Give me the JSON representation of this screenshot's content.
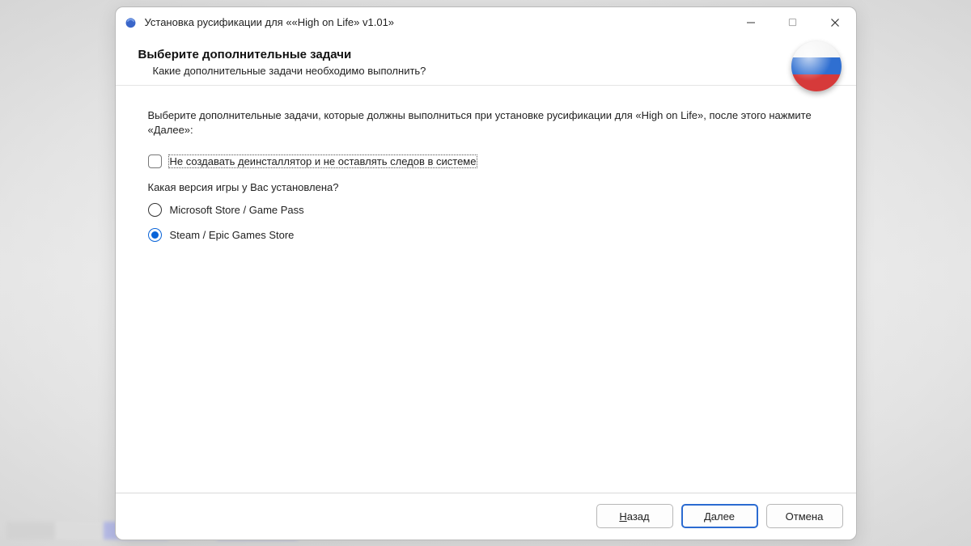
{
  "window_title": "Установка русификации для ««High on Life» v1.01»",
  "header": {
    "title": "Выберите дополнительные задачи",
    "subtitle": "Какие дополнительные задачи необходимо выполнить?"
  },
  "content": {
    "intro": "Выберите дополнительные задачи, которые должны выполниться при установке русификации для «High on Life», после этого нажмите «Далее»:",
    "checkbox_label": "Не создавать деинсталлятор и не оставлять следов в системе",
    "question": "Какая версия игры у Вас установлена?",
    "radio_options": [
      {
        "label": "Microsoft Store / Game Pass",
        "selected": false
      },
      {
        "label": "Steam / Epic Games Store",
        "selected": true
      }
    ]
  },
  "footer": {
    "back_prefix": "Н",
    "back_rest": "азад",
    "next_prefix": "Д",
    "next_rest": "алее",
    "cancel": "Отмена"
  }
}
